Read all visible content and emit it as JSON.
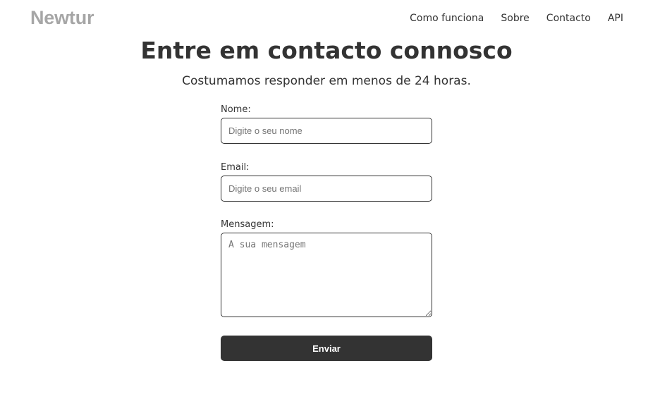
{
  "header": {
    "brand": "Newtur",
    "nav": [
      {
        "label": "Como funciona"
      },
      {
        "label": "Sobre"
      },
      {
        "label": "Contacto"
      },
      {
        "label": "API"
      }
    ]
  },
  "main": {
    "title": "Entre em contacto connosco",
    "subtitle": "Costumamos responder em menos de 24 horas."
  },
  "form": {
    "name": {
      "label": "Nome:",
      "placeholder": "Digite o seu nome",
      "value": ""
    },
    "email": {
      "label": "Email:",
      "placeholder": "Digite o seu email",
      "value": ""
    },
    "message": {
      "label": "Mensagem:",
      "placeholder": "A sua mensagem",
      "value": ""
    },
    "submit_label": "Enviar"
  },
  "colors": {
    "text": "#333333",
    "brand": "#a6a6a6",
    "button_bg": "#333333",
    "button_text": "#ffffff"
  }
}
